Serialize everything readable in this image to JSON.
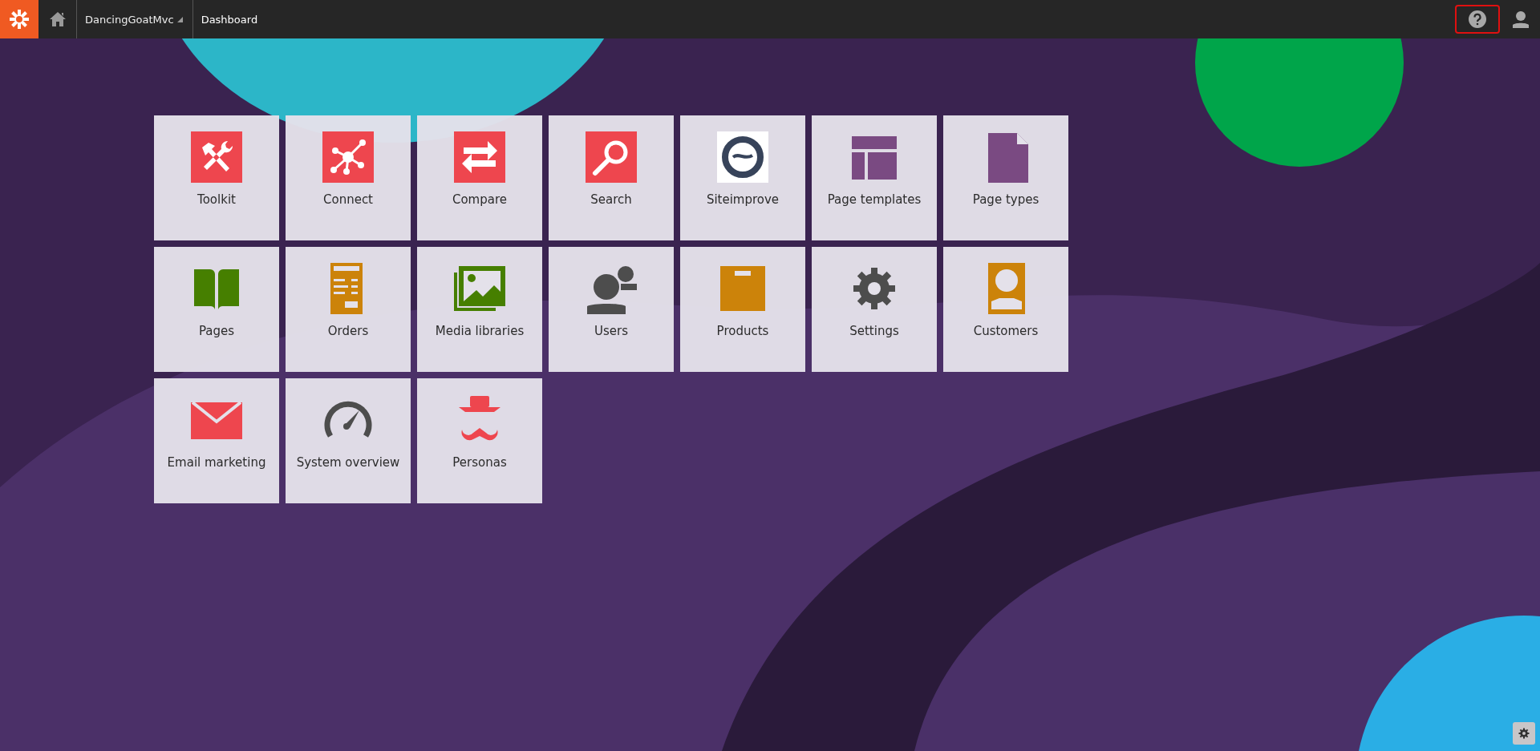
{
  "header": {
    "site": "DancingGoatMvc",
    "breadcrumb": "Dashboard"
  },
  "tiles": [
    {
      "label": "Toolkit"
    },
    {
      "label": "Connect"
    },
    {
      "label": "Compare"
    },
    {
      "label": "Search"
    },
    {
      "label": "Siteimprove"
    },
    {
      "label": "Page templates"
    },
    {
      "label": "Page types"
    },
    {
      "label": "Pages"
    },
    {
      "label": "Orders"
    },
    {
      "label": "Media libraries"
    },
    {
      "label": "Users"
    },
    {
      "label": "Products"
    },
    {
      "label": "Settings"
    },
    {
      "label": "Customers"
    },
    {
      "label": "Email marketing"
    },
    {
      "label": "System overview"
    },
    {
      "label": "Personas"
    }
  ]
}
